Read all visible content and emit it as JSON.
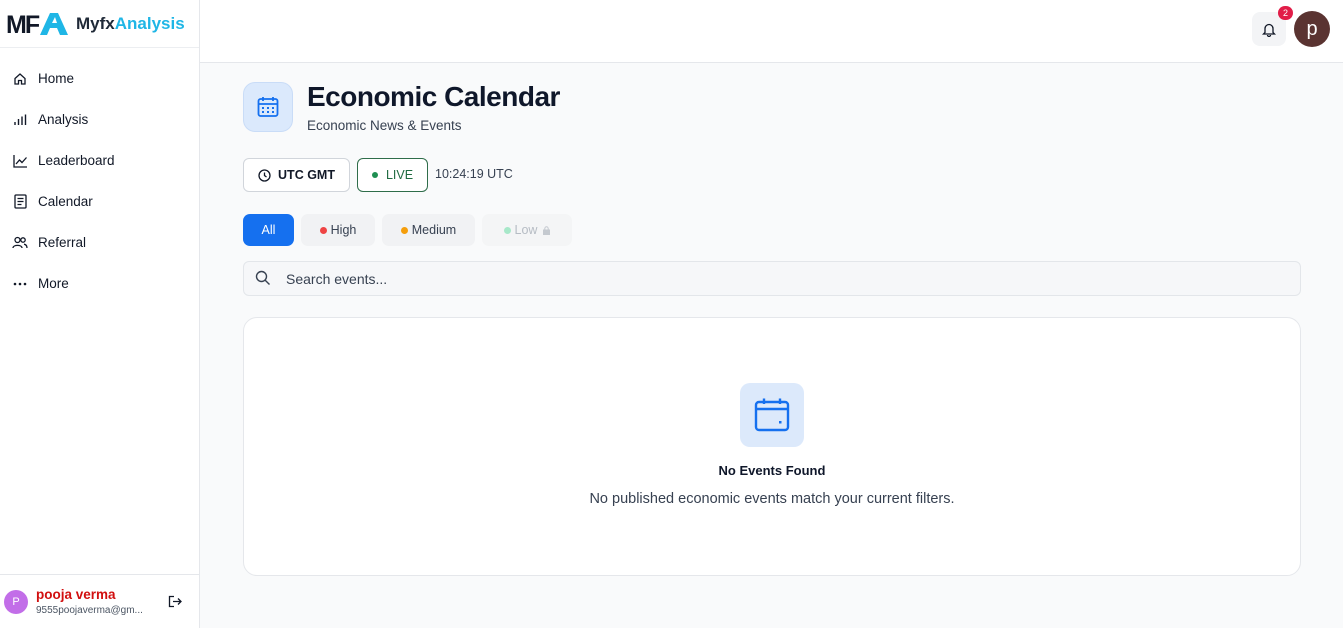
{
  "brand": {
    "logo_text": "MFA",
    "name_part1": "Myfx",
    "name_part2": "Analysis"
  },
  "sidebar": {
    "items": [
      {
        "label": "Home",
        "icon": "home-icon"
      },
      {
        "label": "Analysis",
        "icon": "bar-chart-icon"
      },
      {
        "label": "Leaderboard",
        "icon": "trend-line-icon"
      },
      {
        "label": "Calendar",
        "icon": "list-document-icon"
      },
      {
        "label": "Referral",
        "icon": "users-icon"
      },
      {
        "label": "More",
        "icon": "more-dots-icon"
      }
    ]
  },
  "user": {
    "initial": "P",
    "name": "pooja verma",
    "email": "9555poojaverma@gm..."
  },
  "topbar": {
    "notification_count": "2",
    "avatar_initial": "p"
  },
  "page": {
    "title": "Economic Calendar",
    "subtitle": "Economic News & Events"
  },
  "controls": {
    "timezone_label": "UTC GMT",
    "live_label": "LIVE",
    "clock": "10:24:19 UTC"
  },
  "filters": {
    "all": "All",
    "high": "High",
    "medium": "Medium",
    "low": "Low"
  },
  "search": {
    "placeholder": "Search events...",
    "value": ""
  },
  "empty_state": {
    "title": "No Events Found",
    "message": "No published economic events match your current filters."
  },
  "colors": {
    "primary": "#1570ef",
    "high": "#ef4444",
    "medium": "#f59e0b",
    "low": "#34d399",
    "brand_accent": "#1fb6e6",
    "user_name": "#d10f0f"
  }
}
